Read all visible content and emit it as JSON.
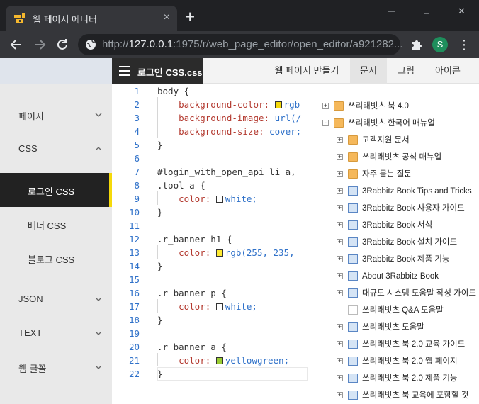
{
  "browser": {
    "tab_title": "웹 페이지 에디터",
    "close_glyph": "×",
    "new_tab_glyph": "+",
    "window_controls": [
      "─",
      "□",
      "✕"
    ],
    "url_host": "127.0.0.1",
    "url_prefix": "http://",
    "url_rest": ":1975/r/web_page_editor/open_editor/a921282...",
    "avatar_letter": "S",
    "kebab": "⋮"
  },
  "app": {
    "file_tab": "로그인 CSS.css",
    "menu": [
      {
        "label": "웹 페이지 만들기",
        "active": false
      },
      {
        "label": "문서",
        "active": true
      },
      {
        "label": "그림",
        "active": false
      },
      {
        "label": "아이콘",
        "active": false
      }
    ]
  },
  "sidebar": {
    "items": [
      {
        "label": "페이지",
        "chevron": "down",
        "child": false,
        "selected": false
      },
      {
        "label": "CSS",
        "chevron": "up",
        "child": false,
        "selected": false
      },
      {
        "label": "로그인 CSS",
        "chevron": "",
        "child": true,
        "selected": true
      },
      {
        "label": "배너 CSS",
        "chevron": "",
        "child": true,
        "selected": false
      },
      {
        "label": "블로그 CSS",
        "chevron": "",
        "child": true,
        "selected": false
      },
      {
        "label": "JSON",
        "chevron": "down",
        "child": false,
        "selected": false
      },
      {
        "label": "TEXT",
        "chevron": "down",
        "child": false,
        "selected": false
      },
      {
        "label": "웹 글꼴",
        "chevron": "down",
        "child": false,
        "selected": false
      }
    ]
  },
  "editor": {
    "lines": [
      {
        "n": "1",
        "parts": [
          {
            "t": "body {",
            "c": "sel"
          }
        ]
      },
      {
        "n": "2",
        "parts": [
          {
            "t": "    background-color: ",
            "c": "prop"
          },
          {
            "sw": "#f5d90a"
          },
          {
            "t": "rgb",
            "c": "val"
          }
        ]
      },
      {
        "n": "3",
        "parts": [
          {
            "t": "    background-image: ",
            "c": "prop"
          },
          {
            "t": "url(/",
            "c": "val"
          }
        ]
      },
      {
        "n": "4",
        "parts": [
          {
            "t": "    background-size: ",
            "c": "prop"
          },
          {
            "t": "cover;",
            "c": "val"
          }
        ]
      },
      {
        "n": "5",
        "parts": [
          {
            "t": "}",
            "c": "sel"
          }
        ]
      },
      {
        "n": "6",
        "parts": []
      },
      {
        "n": "7",
        "parts": [
          {
            "t": "#login_with_open_api li a,",
            "c": "sel"
          }
        ]
      },
      {
        "n": "8",
        "parts": [
          {
            "t": ".tool a {",
            "c": "sel"
          }
        ]
      },
      {
        "n": "9",
        "parts": [
          {
            "t": "    color: ",
            "c": "prop"
          },
          {
            "sw": "#ffffff"
          },
          {
            "t": "white;",
            "c": "val"
          }
        ]
      },
      {
        "n": "10",
        "parts": [
          {
            "t": "}",
            "c": "sel"
          }
        ]
      },
      {
        "n": "11",
        "parts": []
      },
      {
        "n": "12",
        "parts": [
          {
            "t": ".r_banner h1 {",
            "c": "sel"
          }
        ]
      },
      {
        "n": "13",
        "parts": [
          {
            "t": "    color: ",
            "c": "prop"
          },
          {
            "sw": "#ffeb32"
          },
          {
            "t": "rgb(255, 235,",
            "c": "val"
          }
        ]
      },
      {
        "n": "14",
        "parts": [
          {
            "t": "}",
            "c": "sel"
          }
        ]
      },
      {
        "n": "15",
        "parts": []
      },
      {
        "n": "16",
        "parts": [
          {
            "t": ".r_banner p {",
            "c": "sel"
          }
        ]
      },
      {
        "n": "17",
        "parts": [
          {
            "t": "    color: ",
            "c": "prop"
          },
          {
            "sw": "#ffffff"
          },
          {
            "t": "white;",
            "c": "val"
          }
        ]
      },
      {
        "n": "18",
        "parts": [
          {
            "t": "}",
            "c": "sel"
          }
        ]
      },
      {
        "n": "19",
        "parts": []
      },
      {
        "n": "20",
        "parts": [
          {
            "t": ".r_banner a {",
            "c": "sel"
          }
        ]
      },
      {
        "n": "21",
        "parts": [
          {
            "t": "    color: ",
            "c": "prop"
          },
          {
            "sw": "#9acd32"
          },
          {
            "t": "yellowgreen;",
            "c": "val"
          }
        ]
      },
      {
        "n": "22",
        "parts": [
          {
            "t": "}",
            "c": "sel"
          }
        ]
      }
    ]
  },
  "tree": {
    "nodes": [
      {
        "label": "쓰리래빗츠 북 4.0",
        "level": 0,
        "icon": "folder",
        "expander": "+"
      },
      {
        "label": "쓰리래빗츠 한국어 매뉴얼",
        "level": 0,
        "icon": "folder",
        "expander": "-"
      },
      {
        "label": "고객지원 문서",
        "level": 1,
        "icon": "folder",
        "expander": "+"
      },
      {
        "label": "쓰리래빗츠 공식 매뉴얼",
        "level": 1,
        "icon": "folder",
        "expander": "+"
      },
      {
        "label": "자주 묻는 질문",
        "level": 1,
        "icon": "folder",
        "expander": "+"
      },
      {
        "label": "3Rabbitz Book Tips and Tricks",
        "level": 1,
        "icon": "doc",
        "expander": "+"
      },
      {
        "label": "3Rabbitz Book 사용자 가이드",
        "level": 1,
        "icon": "doc",
        "expander": "+"
      },
      {
        "label": "3Rabbitz Book 서식",
        "level": 1,
        "icon": "doc",
        "expander": "+"
      },
      {
        "label": "3Rabbitz Book 설치 가이드",
        "level": 1,
        "icon": "doc",
        "expander": "+"
      },
      {
        "label": "3Rabbitz Book 제품 기능",
        "level": 1,
        "icon": "doc",
        "expander": "+"
      },
      {
        "label": "About 3Rabbitz Book",
        "level": 1,
        "icon": "doc",
        "expander": "+"
      },
      {
        "label": "대규모 시스템 도움말 작성 가이드",
        "level": 1,
        "icon": "doc",
        "expander": "+"
      },
      {
        "label": "쓰리래빗츠 Q&A 도움말",
        "level": 1,
        "icon": "page",
        "expander": ""
      },
      {
        "label": "쓰리래빗츠 도움말",
        "level": 1,
        "icon": "doc",
        "expander": "+"
      },
      {
        "label": "쓰리래빗츠 북 2.0 교육 가이드",
        "level": 1,
        "icon": "doc",
        "expander": "+"
      },
      {
        "label": "쓰리래빗츠 북 2.0 웹 페이지",
        "level": 1,
        "icon": "doc",
        "expander": "+"
      },
      {
        "label": "쓰리래빗츠 북 2.0 제품 기능",
        "level": 1,
        "icon": "doc",
        "expander": "+"
      },
      {
        "label": "쓰리래빗츠 북 교육에 포함할 것",
        "level": 1,
        "icon": "doc",
        "expander": "+"
      }
    ]
  }
}
